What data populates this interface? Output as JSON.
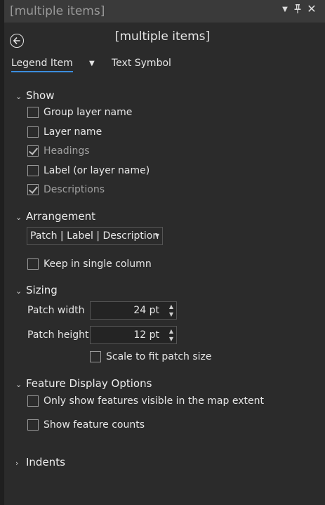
{
  "window": {
    "title": "[multiple items]",
    "icons": [
      "chevron-down-icon",
      "pin-icon",
      "close-icon"
    ]
  },
  "header": {
    "title": "[multiple items]"
  },
  "tabs": [
    {
      "label": "Legend Item",
      "active": true
    },
    {
      "label": "Text Symbol",
      "active": false
    }
  ],
  "show": {
    "label": "Show",
    "items": [
      {
        "label": "Group layer name",
        "checked": false
      },
      {
        "label": "Layer name",
        "checked": false
      },
      {
        "label": "Headings",
        "checked": true
      },
      {
        "label": "Label (or layer name)",
        "checked": false
      },
      {
        "label": "Descriptions",
        "checked": true
      }
    ]
  },
  "arrangement": {
    "label": "Arrangement",
    "selected": "Patch | Label | Description",
    "single_column": {
      "label": "Keep in single column",
      "checked": false
    }
  },
  "sizing": {
    "label": "Sizing",
    "patch_width": {
      "label": "Patch width",
      "value": "24 pt"
    },
    "patch_height": {
      "label": "Patch height",
      "value": "12 pt"
    },
    "scale": {
      "label": "Scale to fit patch size",
      "checked": false
    }
  },
  "feature_display": {
    "label": "Feature Display Options",
    "visible_only": {
      "label": "Only show features visible in the map extent",
      "checked": false
    },
    "counts": {
      "label": "Show feature counts",
      "checked": false
    }
  },
  "indents": {
    "label": "Indents"
  },
  "colors": {
    "accent": "#3b8ddd",
    "background": "#2b2b2b",
    "titlebar": "#3a3a3a"
  }
}
